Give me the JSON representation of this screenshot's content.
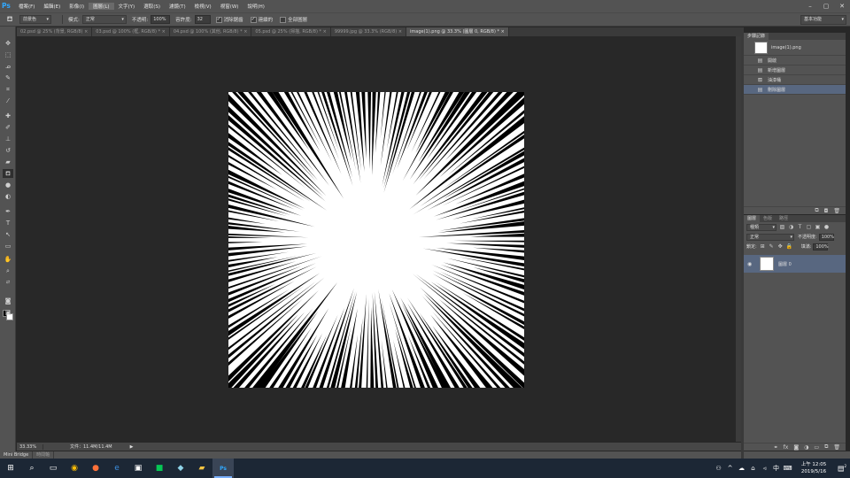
{
  "app": {
    "logo": "Ps",
    "menu": [
      "檔案(F)",
      "編輯(E)",
      "影像(I)",
      "圖層(L)",
      "文字(Y)",
      "選取(S)",
      "濾鏡(T)",
      "檢視(V)",
      "視窗(W)",
      "說明(H)"
    ]
  },
  "window_controls": {
    "minimize": "–",
    "maximize": "▢",
    "close": "✕"
  },
  "options": {
    "fill_source": "前景色",
    "mode_label": "模式:",
    "mode_value": "正常",
    "opacity_label": "不透明:",
    "opacity_value": "100%",
    "tolerance_label": "容許度:",
    "tolerance_value": "32",
    "antialias_label": "消除鋸齒",
    "contiguous_label": "連續的",
    "all_layers_label": "全部圖層",
    "workspace_value": "基本功能"
  },
  "tabs": [
    {
      "label": "02.psd @ 25% (背景, RGB/8) ×"
    },
    {
      "label": "03.psd @ 100% (框, RGB/8) * ×"
    },
    {
      "label": "04.psd @ 100% (其他, RGB/8) * ×"
    },
    {
      "label": "05.psd @ 25% (掃描, RGB/8) * ×"
    },
    {
      "label": "99999.jpg @ 33.3% (RGB/8) ×"
    },
    {
      "label": "image(1).png @ 33.3% (圖層 0, RGB/8) * ×"
    }
  ],
  "status": {
    "zoom": "33.33%",
    "doc_size": "文件：11.4M/11.4M",
    "arrow": "▶"
  },
  "bottom_tabs": [
    "Mini Bridge",
    "時間軸"
  ],
  "history": {
    "tabs": [
      "步驟記錄"
    ],
    "snapshot": "image(1).png",
    "items": [
      {
        "label": "開啟",
        "icon": "document-icon"
      },
      {
        "label": "新增圖層",
        "icon": "document-icon"
      },
      {
        "label": "油漆桶",
        "icon": "paint-bucket-icon"
      },
      {
        "label": "刪除圖層",
        "icon": "document-icon"
      }
    ]
  },
  "layers": {
    "tabs": [
      "圖層",
      "色版",
      "路徑"
    ],
    "kind_filter": "種類",
    "blend_mode": "正常",
    "opacity_label": "不透明度:",
    "opacity_value": "100%",
    "lock_label": "鎖定:",
    "fill_label": "填滿:",
    "fill_value": "100%",
    "layer_name": "圖層 0"
  },
  "taskbar": {
    "time": "上午 12:05",
    "date": "2019/5/16",
    "notification_count": "2"
  },
  "colors": {
    "accent": "#31a8ff",
    "selection": "#586780"
  }
}
